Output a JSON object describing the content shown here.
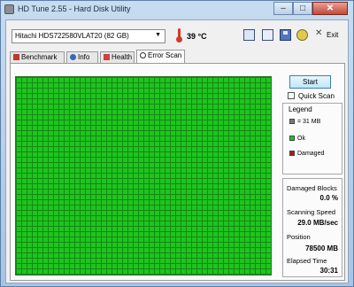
{
  "window": {
    "title": "HD Tune 2.55 - Hard Disk Utility",
    "minimize_glyph": "–",
    "maximize_glyph": "□",
    "close_glyph": "✕"
  },
  "toolbar": {
    "drive_selected": "Hitachi HDS722580VLAT20 (82 GB)",
    "temperature": "39 °C",
    "exit_label": "Exit"
  },
  "tabs": [
    {
      "label": "Benchmark",
      "icon": "benchmark-icon",
      "active": false
    },
    {
      "label": "Info",
      "icon": "info-icon",
      "active": false
    },
    {
      "label": "Health",
      "icon": "health-icon",
      "active": false
    },
    {
      "label": "Error Scan",
      "icon": "error-scan-icon",
      "active": true
    }
  ],
  "scan": {
    "start_label": "Start",
    "quick_scan_label": "Quick Scan",
    "quick_scan_checked": false,
    "block_color_ok": "#1fc41f",
    "block_border_color": "#128a12",
    "legend": {
      "title": "Legend",
      "block_size": "= 31 MB",
      "ok": "Ok",
      "damaged": "Damaged",
      "ok_color": "#1fc41f",
      "damaged_color": "#b01818",
      "block_color": "#7a7a7a"
    },
    "stats": {
      "damaged_blocks_label": "Damaged Blocks",
      "damaged_blocks_value": "0.0 %",
      "scanning_speed_label": "Scanning Speed",
      "scanning_speed_value": "29.0 MB/sec",
      "position_label": "Position",
      "position_value": "78500 MB",
      "elapsed_time_label": "Elapsed Time",
      "elapsed_time_value": "30:31"
    }
  }
}
